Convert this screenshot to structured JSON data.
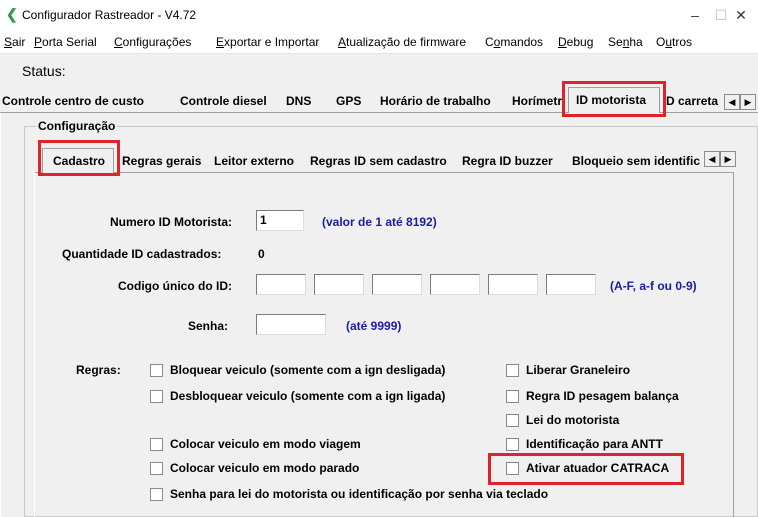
{
  "window": {
    "title": "Configurador Rastreador - V4.72",
    "minimize": "–",
    "maximize": "☐",
    "close": "✕"
  },
  "menu": [
    {
      "key": "S",
      "rest": "air"
    },
    {
      "key": "P",
      "rest": "orta Serial"
    },
    {
      "key": "C",
      "rest": "onfigurações"
    },
    {
      "key": "E",
      "rest": "xportar e Importar"
    },
    {
      "key": "A",
      "rest": "tualização de firmware"
    },
    {
      "pre": "C",
      "key": "o",
      "rest": "mandos"
    },
    {
      "key": "D",
      "rest": "ebug"
    },
    {
      "pre": "Se",
      "key": "n",
      "rest": "ha"
    },
    {
      "pre": "O",
      "key": "u",
      "rest": "tros"
    }
  ],
  "status_label": "Status:",
  "outer_tabs": [
    "Controle centro de custo",
    "Controle diesel",
    "DNS",
    "GPS",
    "Horário de trabalho",
    "Horímetr",
    "ID motorista",
    "D carreta"
  ],
  "outer_active_tab": "ID motorista",
  "group_title": "Configuração",
  "inner_tabs": [
    "Cadastro",
    "Regras gerais",
    "Leitor externo",
    "Regras ID sem cadastro",
    "Regra ID buzzer",
    "Bloqueio sem identific"
  ],
  "inner_active_tab": "Cadastro",
  "form": {
    "numero_label": "Numero ID Motorista:",
    "numero_value": "1",
    "numero_hint": "(valor de 1 até 8192)",
    "quantidade_label": "Quantidade ID cadastrados:",
    "quantidade_value": "0",
    "codigo_label": "Codigo único do ID:",
    "codigo_values": [
      "",
      "",
      "",
      "",
      "",
      ""
    ],
    "codigo_hint": "(A-F, a-f ou 0-9)",
    "senha_label": "Senha:",
    "senha_value": "",
    "senha_hint": "(até 9999)",
    "regras_label": "Regras:"
  },
  "checkboxes": {
    "bloquear": {
      "label": "Bloquear veiculo (somente com a ign desligada)",
      "checked": false
    },
    "desbloquear": {
      "label": "Desbloquear veiculo (somente com a ign ligada)",
      "checked": false
    },
    "viagem": {
      "label": "Colocar veiculo em modo viagem",
      "checked": false
    },
    "parado": {
      "label": "Colocar veiculo em modo parado",
      "checked": false
    },
    "senha_lei": {
      "label": "Senha para lei do motorista ou identificação por senha via teclado",
      "checked": false
    },
    "graneleiro": {
      "label": "Liberar Graneleiro",
      "checked": false
    },
    "pesagem": {
      "label": "Regra ID pesagem balança",
      "checked": false
    },
    "lei": {
      "label": "Lei do motorista",
      "checked": false
    },
    "antt": {
      "label": "Identificação para ANTT",
      "checked": false
    },
    "catraca": {
      "label": "Ativar atuador CATRACA",
      "checked": false
    }
  },
  "highlight_color": "#e0232b",
  "hint_color": "#1a1aa6"
}
